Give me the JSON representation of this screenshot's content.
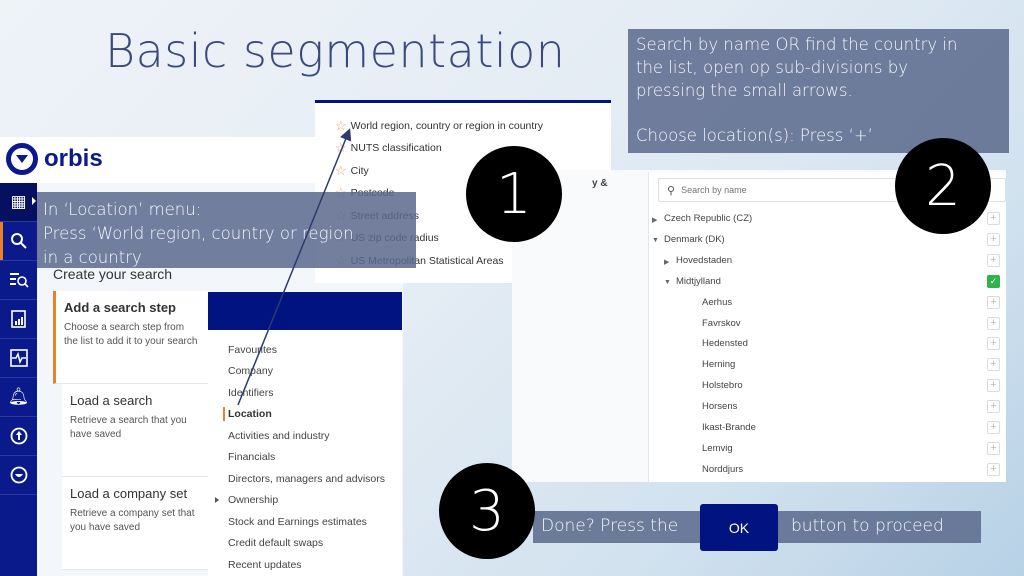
{
  "slide": {
    "title": "Basic segmentation"
  },
  "app": {
    "brand": "orbis",
    "nav_icons": [
      "companies-icon",
      "search-icon",
      "search-list-icon",
      "report-icon",
      "monitoring-icon",
      "notifications-icon",
      "upload-icon",
      "logout-icon"
    ],
    "create_title": "Create your search",
    "cards": [
      {
        "title": "Add a search step",
        "desc": "Choose a search step from the list to add it to your search"
      },
      {
        "title": "Load a search",
        "desc": "Retrieve a search that you have saved"
      },
      {
        "title": "Load a company set",
        "desc": "Retrieve a company set that you have saved"
      }
    ],
    "categories": [
      {
        "label": "Favourites"
      },
      {
        "label": "Company"
      },
      {
        "label": "Identifiers"
      },
      {
        "label": "Location",
        "active": true
      },
      {
        "label": "Activities and industry"
      },
      {
        "label": "Financials"
      },
      {
        "label": "Directors, managers and advisors"
      },
      {
        "label": "Ownership",
        "expandable": true
      },
      {
        "label": "Stock and Earnings estimates"
      },
      {
        "label": "Credit default swaps"
      },
      {
        "label": "Recent updates"
      }
    ],
    "location_items": [
      "World region, country or region in country",
      "NUTS classification",
      "City",
      "Postcode",
      "Street address",
      "US zip code radius",
      "US Metropolitan Statistical Areas"
    ],
    "country_panel": {
      "left_label": "y &",
      "search_placeholder": "Search by name",
      "rows": [
        {
          "label": "Czech Republic (CZ)",
          "level": 0,
          "toggle": "collapsed",
          "selected": false
        },
        {
          "label": "Denmark (DK)",
          "level": 0,
          "toggle": "expanded",
          "selected": false
        },
        {
          "label": "Hovedstaden",
          "level": 1,
          "toggle": "collapsed",
          "selected": false
        },
        {
          "label": "Midtjylland",
          "level": 1,
          "toggle": "expanded",
          "selected": true
        },
        {
          "label": "Aerhus",
          "level": 2,
          "toggle": "none",
          "selected": false
        },
        {
          "label": "Favrskov",
          "level": 2,
          "toggle": "none",
          "selected": false
        },
        {
          "label": "Hedensted",
          "level": 2,
          "toggle": "none",
          "selected": false
        },
        {
          "label": "Herning",
          "level": 2,
          "toggle": "none",
          "selected": false
        },
        {
          "label": "Holstebro",
          "level": 2,
          "toggle": "none",
          "selected": false
        },
        {
          "label": "Horsens",
          "level": 2,
          "toggle": "none",
          "selected": false
        },
        {
          "label": "Ikast-Brande",
          "level": 2,
          "toggle": "none",
          "selected": false
        },
        {
          "label": "Lemvig",
          "level": 2,
          "toggle": "none",
          "selected": false
        },
        {
          "label": "Norddjurs",
          "level": 2,
          "toggle": "none",
          "selected": false
        }
      ],
      "plus_symbol": "+",
      "check_symbol": "✓"
    }
  },
  "instructions": {
    "step1": {
      "badge": "1",
      "lines": [
        "In ‘Location’ menu:",
        "Press ‘World region, country or region",
        "in a country"
      ]
    },
    "step2": {
      "badge": "2",
      "lines": [
        "Search by name OR find the country in",
        "the list, open op sub-divisions by",
        "pressing the small arrows."
      ],
      "line2": "Choose location(s): Press ‘+’"
    },
    "step3": {
      "badge": "3",
      "before": "Done? Press the",
      "button": "OK",
      "after": "button to proceed"
    }
  },
  "colors": {
    "brand_navy": "#001380",
    "accent_orange": "#e8822a",
    "selected_green": "#2fb34a",
    "note_bg": "#5a698c"
  }
}
